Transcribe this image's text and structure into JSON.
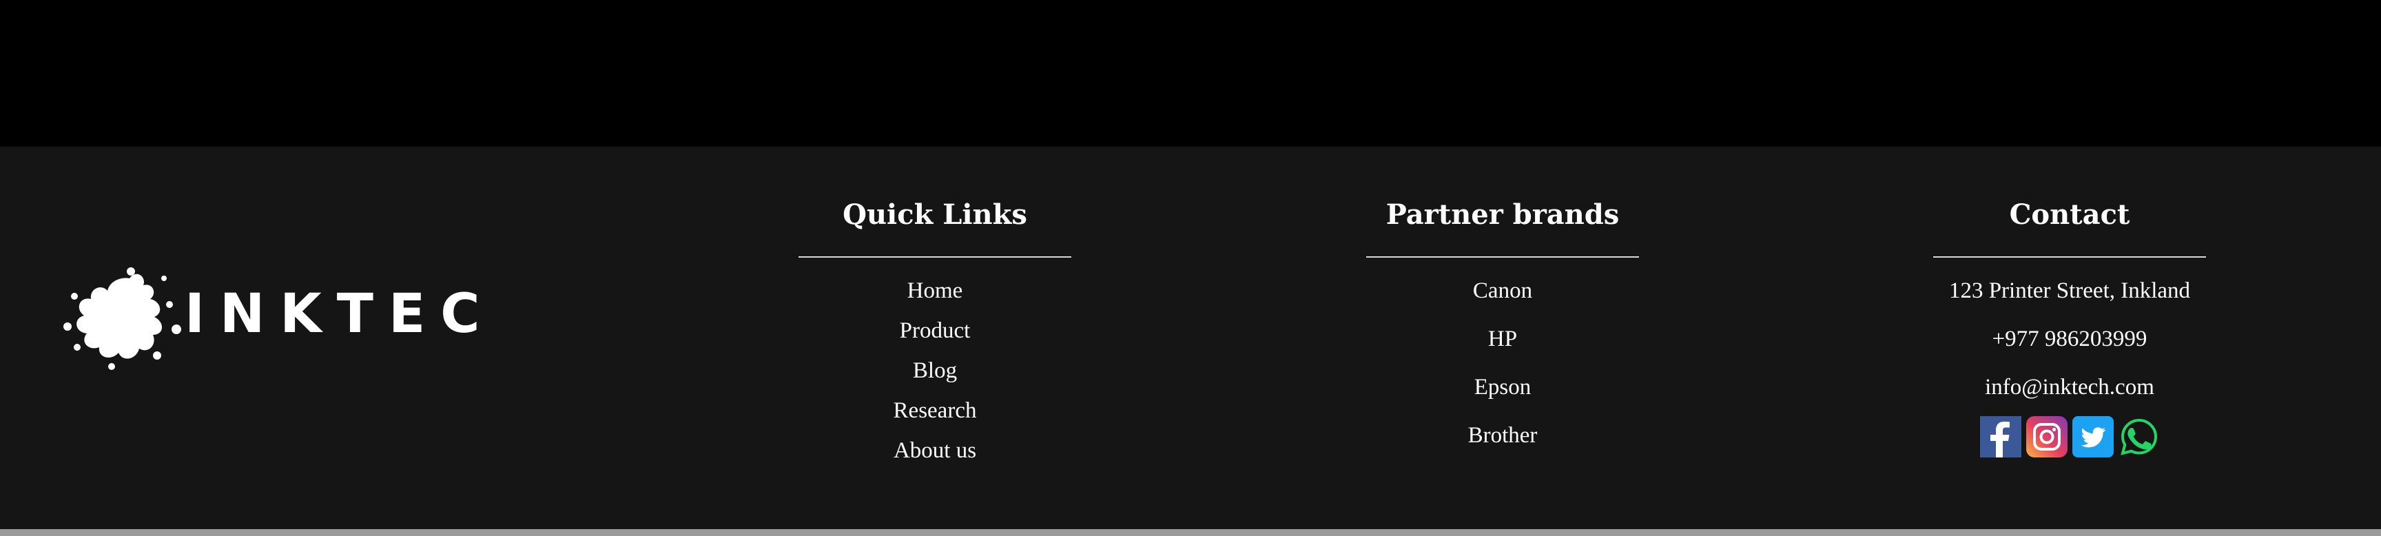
{
  "brand": {
    "logo_text": "INKTECH"
  },
  "quick_links": {
    "title": "Quick Links",
    "items": [
      "Home",
      "Product",
      "Blog",
      "Research",
      "About us"
    ]
  },
  "partner_brands": {
    "title": "Partner brands",
    "items": [
      "Canon",
      "HP",
      "Epson",
      "Brother"
    ]
  },
  "contact": {
    "title": "Contact",
    "address": "123 Printer Street, Inkland",
    "phone": "+977 986203999",
    "email": "info@inktech.com",
    "socials": [
      "facebook-icon",
      "instagram-icon",
      "twitter-icon",
      "whatsapp-icon"
    ]
  },
  "colors": {
    "footer_bg": "#151515",
    "top_bg": "#000000",
    "facebook": "#3b5998",
    "twitter": "#1da1f2",
    "whatsapp": "#25d366"
  }
}
